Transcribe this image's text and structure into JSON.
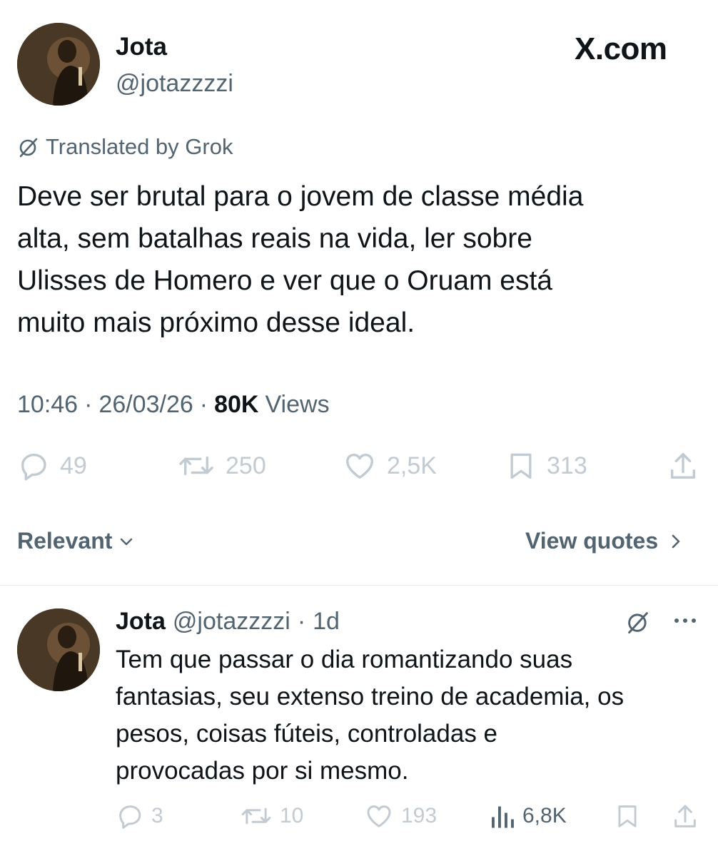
{
  "header": {
    "display_name": "Jota",
    "handle": "@jotazzzzi",
    "brand": "X.com"
  },
  "post": {
    "translated_label": "Translated by Grok",
    "text_lines": [
      "Deve ser brutal para o jovem de classe média",
      "alta, sem batalhas reais na vida, ler sobre",
      "Ulisses de Homero e ver que o Oruam está",
      "muito mais próximo desse ideal."
    ],
    "time": "10:46",
    "date": "26/03/26",
    "separator": "·",
    "views_count": "80K",
    "views_label": "Views",
    "stats": {
      "replies": "49",
      "reposts": "250",
      "likes": "2,5K",
      "bookmarks": "313"
    }
  },
  "sort": {
    "label": "Relevant",
    "quotes_label": "View quotes"
  },
  "reply": {
    "display_name": "Jota",
    "handle": "@jotazzzzi",
    "separator": "·",
    "age": "1d",
    "text_lines": [
      "Tem que passar o dia romantizando suas",
      "fantasias, seu extenso treino de academia, os",
      "pesos, coisas fúteis, controladas e",
      "provocadas por si mesmo."
    ],
    "stats": {
      "replies": "3",
      "reposts": "10",
      "likes": "193",
      "views": "6,8K"
    }
  },
  "colors": {
    "text": "#0f1419",
    "secondary": "#536471",
    "faded_icon": "#c3cbd2",
    "divider": "#e6ebee"
  }
}
